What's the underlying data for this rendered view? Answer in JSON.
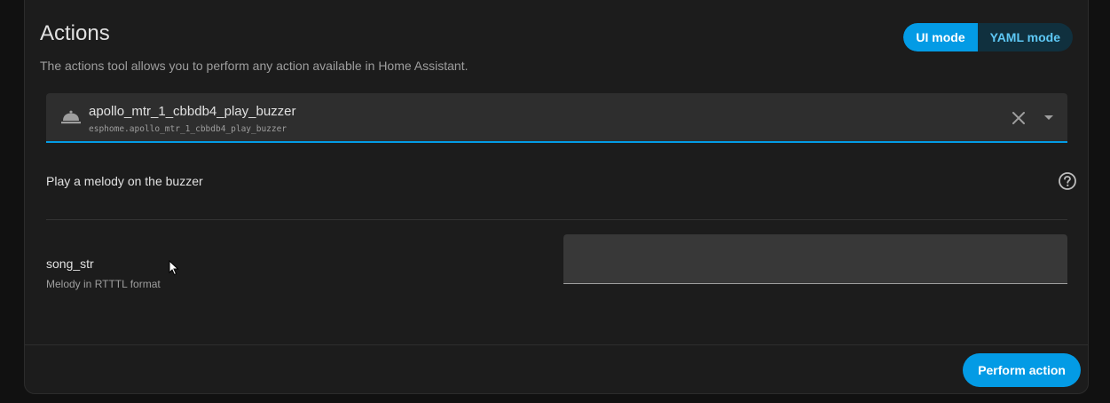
{
  "card": {
    "title": "Actions",
    "description": "The actions tool allows you to perform any action available in Home Assistant."
  },
  "mode_toggle": {
    "ui_label": "UI mode",
    "yaml_label": "YAML mode"
  },
  "action_select": {
    "icon": "bell-icon",
    "name": "apollo_mtr_1_cbbdb4_play_buzzer",
    "service_id": "esphome.apollo_mtr_1_cbbdb4_play_buzzer"
  },
  "action_info": {
    "description": "Play a melody on the buzzer"
  },
  "fields": [
    {
      "name": "song_str",
      "description": "Melody in RTTTL format",
      "value": ""
    }
  ],
  "footer": {
    "perform_label": "Perform action"
  },
  "colors": {
    "accent": "#039be5",
    "background": "#111111",
    "card": "#1c1c1c"
  }
}
